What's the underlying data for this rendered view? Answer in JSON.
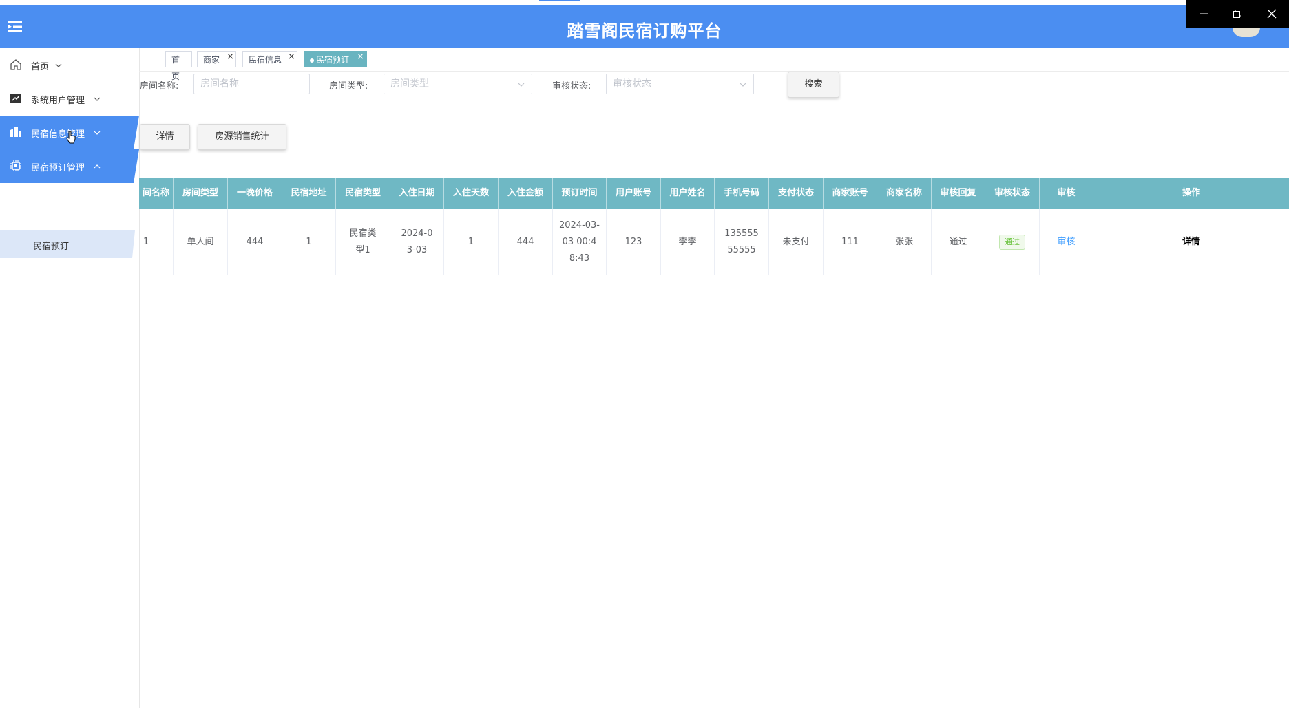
{
  "app": {
    "title": "踏雪阁民宿订购平台"
  },
  "window_controls": {
    "minimize": "—",
    "restore": "❐",
    "close": "✕"
  },
  "sidebar": {
    "items": [
      {
        "label": "首页",
        "icon": "home-icon",
        "expanded": false
      },
      {
        "label": "系统用户管理",
        "icon": "user-admin-icon",
        "expanded": false
      },
      {
        "label": "民宿信息管理",
        "icon": "building-icon",
        "expanded": false
      },
      {
        "label": "民宿预订管理",
        "icon": "chip-icon",
        "expanded": true
      }
    ],
    "subitems": [
      {
        "label": "民宿预订"
      }
    ],
    "accent": "#4b8ef1"
  },
  "tabs": [
    {
      "label": "首页",
      "closable": false
    },
    {
      "label": "商家",
      "closable": true
    },
    {
      "label": "民宿信息",
      "closable": true
    },
    {
      "label": "民宿预订",
      "closable": true,
      "active": true
    }
  ],
  "search": {
    "room_name_label": "房间名称:",
    "room_name_placeholder": "房间名称",
    "room_type_label": "房间类型:",
    "room_type_placeholder": "房间类型",
    "status_label": "审核状态:",
    "status_placeholder": "审核状态",
    "search_button": "搜索"
  },
  "actions": {
    "detail_button": "详情",
    "stats_button": "房源销售统计"
  },
  "table": {
    "header_color": "#6fb8c4",
    "columns": [
      "间名称",
      "房间类型",
      "一晚价格",
      "民宿地址",
      "民宿类型",
      "入住日期",
      "入住天数",
      "入住金额",
      "预订时间",
      "用户账号",
      "用户姓名",
      "手机号码",
      "支付状态",
      "商家账号",
      "商家名称",
      "审核回复",
      "审核状态",
      "审核",
      "操作"
    ],
    "rows": [
      {
        "cells": [
          "1",
          "单人间",
          "444",
          "1",
          "民宿类型1",
          "2024-03-03",
          "1",
          "444",
          "2024-03-03 00:48:43",
          "123",
          "李李",
          "13555555555",
          "未支付",
          "111",
          "张张",
          "通过"
        ],
        "status_tag": "通过",
        "audit_link": "审核",
        "operation": "详情"
      }
    ]
  }
}
